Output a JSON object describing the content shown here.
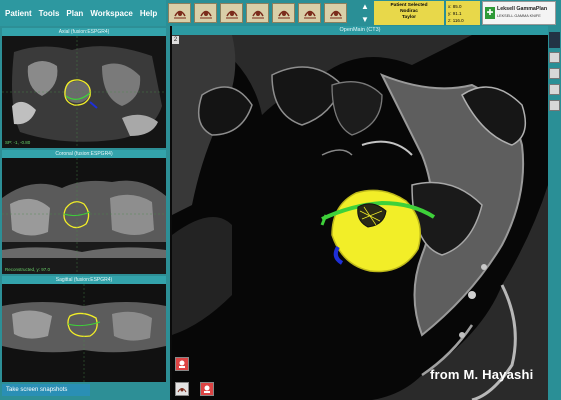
{
  "menu": [
    "Patient",
    "Tools",
    "Plan",
    "Workspace",
    "Help"
  ],
  "toolbar": {
    "buttons": [
      "tool-1",
      "tool-2",
      "tool-3",
      "tool-4",
      "tool-5",
      "tool-6",
      "tool-7"
    ],
    "icon": "gamma-head-icon"
  },
  "status": {
    "line1": "Patient Selected",
    "line2": "Nodirac",
    "line3": "Taylor"
  },
  "coords": {
    "x": "x: 85.0",
    "y": "y: 91.1",
    "z": "z: 116.0"
  },
  "brand": {
    "title": "Leksell GammaPlan",
    "subtitle": "LEKSELL GAMMA KNIFE"
  },
  "panes": {
    "axial": {
      "title": "Axial (fusion:ESPGR4)",
      "info": "SP: -1, -0.80"
    },
    "coronal": {
      "title": "Coronal (fusion:ESPGR4)",
      "info": "Reconstructed, y: 97.0"
    },
    "sagittal": {
      "title": "Sagittal (fusion:ESPGR4)"
    }
  },
  "main": {
    "title": "OpenMain (CT3)",
    "corner_label": "2"
  },
  "snapshot": "Take screen snapshots",
  "credit": "from M. Hayashi",
  "colors": {
    "teal": "#2d8f96",
    "status_yellow": "#e8d84a",
    "tumor_yellow": "#f2ee28",
    "contour_green": "#3ed13a",
    "vessel_blue": "#1e2fd8"
  }
}
